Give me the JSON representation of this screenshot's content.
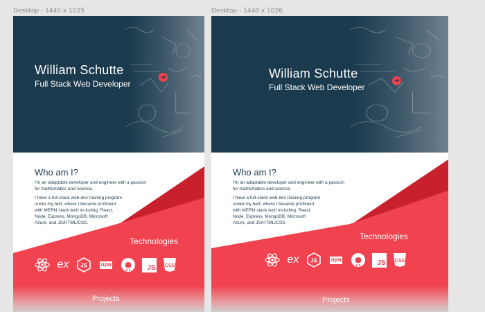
{
  "canvas": {
    "frames": [
      {
        "label": "Desktop - 1440 x 1025",
        "name": "William Schutte",
        "role": "Full Stack Web Developer",
        "about_title": "Who am I?",
        "about_p1": "I'm an adaptable developer and engineer with a passion\nfor mathematics and science.",
        "about_p2": "I have a full-stack web-dev training program\nunder my belt, where I became proficient\nwith MERN stack tech including: React,\nNode, Express, MongoDB, Microsoft\nAzure, and JS/HTML/CSS.",
        "tech_title": "Technologies",
        "projects_title": "Projects"
      },
      {
        "label": "Desktop - 1440 x 1026",
        "name": "William Schutte",
        "role": "Full Stack Web Developer",
        "about_title": "Who am I?",
        "about_p1": "I'm an adaptable developer and engineer with a passion\nfor mathematics and science.",
        "about_p2": "I have a full-stack web-dev training program\nunder my belt, where I became proficient\nwith MERN stack tech including: React,\nNode, Express, MongoDB, Microsoft\nAzure, and JS/HTML/CSS.",
        "tech_title": "Technologies",
        "projects_title": "Projects"
      }
    ]
  },
  "tech_icons": [
    "react-icon",
    "express-icon",
    "nodejs-icon",
    "npm-icon",
    "github-icon",
    "javascript-icon",
    "css3-icon"
  ],
  "icon_text": {
    "express": "ex",
    "npm": "npm",
    "js": "JS",
    "css": "CSS"
  },
  "colors": {
    "navy": "#1b3a4d",
    "red": "#f0434f",
    "dark_red": "#c8202c",
    "white": "#ffffff"
  }
}
